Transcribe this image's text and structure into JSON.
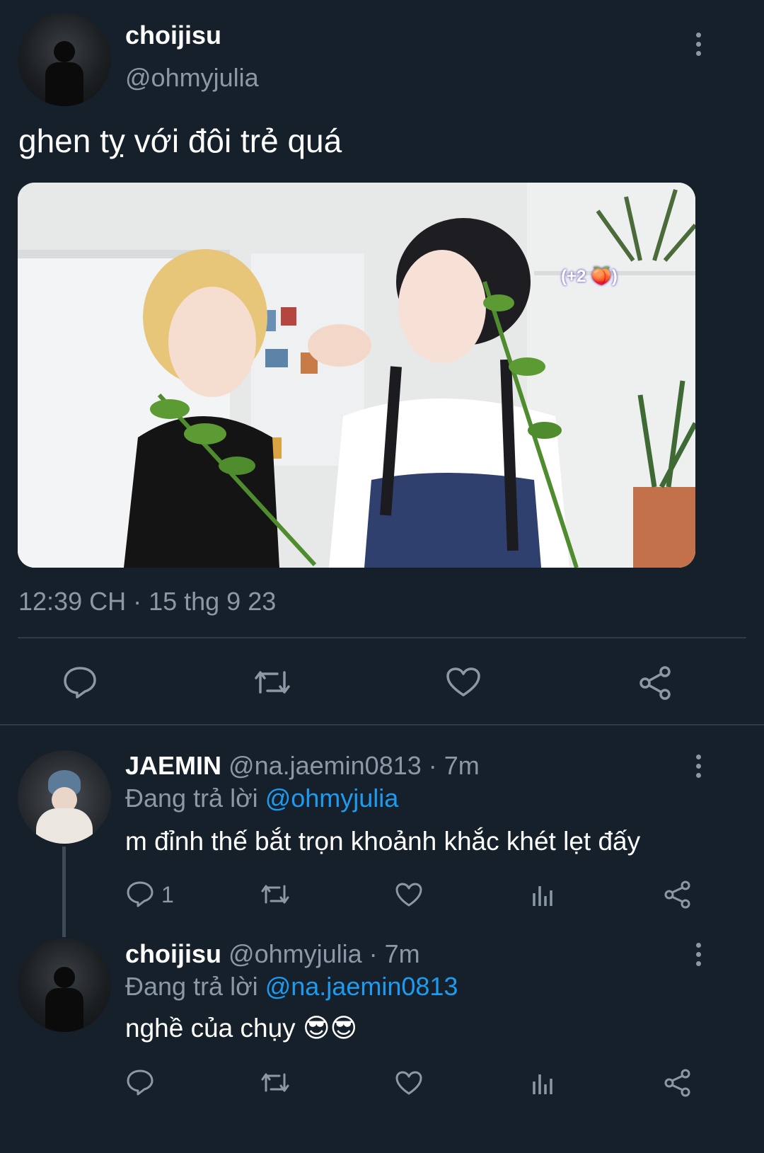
{
  "main_tweet": {
    "display_name": "choijisu",
    "handle": "@ohmyjulia",
    "text": "ghen tỵ với đôi trẻ quá",
    "media_overlay_text": "(+2 🍑)",
    "timestamp": "12:39 CH · 15 thg 9 23"
  },
  "actions": {
    "reply_icon": "reply-icon",
    "retweet_icon": "retweet-icon",
    "like_icon": "heart-icon",
    "share_icon": "share-icon"
  },
  "replies": [
    {
      "display_name": "JAEMIN",
      "meta": "@na.jaemin0813 · 7m",
      "replying_prefix": "Đang trả lời",
      "replying_to": "@ohmyjulia",
      "text": "m đỉnh thế bắt trọn khoảnh khắc khét lẹt đấy",
      "reply_count": "1"
    },
    {
      "display_name": "choijisu",
      "meta": "@ohmyjulia · 7m",
      "replying_prefix": "Đang trả lời",
      "replying_to": "@na.jaemin0813",
      "text": "nghề của chụy 😎😎",
      "reply_count": ""
    }
  ],
  "colors": {
    "background": "#15202b",
    "muted": "#8b98a5",
    "link": "#1d9bf0",
    "divider": "#2f3b47"
  }
}
